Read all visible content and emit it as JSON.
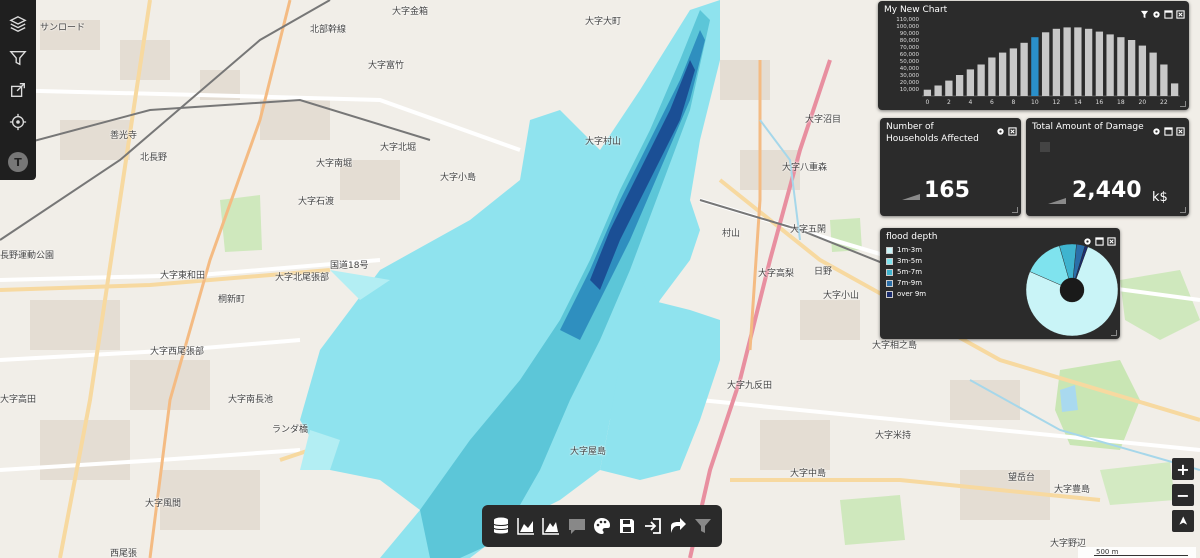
{
  "map": {
    "labels": [
      "大字金箱",
      "大字大町",
      "北部幹線",
      "サンロード",
      "大字富竹",
      "大字石渡",
      "大字北堀",
      "大字南堀",
      "大字小島",
      "大字村山",
      "善光寺",
      "北長野",
      "長野運動公園",
      "大字東和田",
      "大字北尾張部",
      "桐新町",
      "国道18号",
      "大字西尾張部",
      "大字高田",
      "大字南長池",
      "大字屋島",
      "大字八重森",
      "大字五閑",
      "大字高梨",
      "大字小山",
      "大字相之島",
      "大字九反田",
      "大字米持",
      "大字中島",
      "大字豊島",
      "望岳台",
      "大字野辺",
      "大字風間",
      "西尾張",
      "村山",
      "日野",
      "大字沼目",
      "ランダ橋"
    ],
    "route_shields": [
      "60",
      "406",
      "19",
      "58",
      "18",
      "117",
      "34",
      "58",
      "E18",
      "E18"
    ]
  },
  "left_toolbar": {
    "icons": [
      "layers-icon",
      "filter-icon",
      "share-icon",
      "location-icon"
    ],
    "avatar_letter": "T"
  },
  "bar_widget": {
    "title": "My New Chart",
    "highlight_color": "#2a8fc9",
    "bar_color": "#c8c8c8"
  },
  "households_widget": {
    "title_line1": "Number of",
    "title_line2": "Households Affected",
    "value": "165"
  },
  "damage_widget": {
    "title": "Total Amount of Damage",
    "value": "2,440",
    "unit": "k$"
  },
  "flood_widget": {
    "title": "flood depth",
    "legend": [
      {
        "label": "1m-3m",
        "color": "#c9f4f7"
      },
      {
        "label": "3m-5m",
        "color": "#7fe3ee"
      },
      {
        "label": "5m-7m",
        "color": "#3fb4cf"
      },
      {
        "label": "7m-9m",
        "color": "#2a6ea8"
      },
      {
        "label": "over 9m",
        "color": "#1b2d6e"
      }
    ]
  },
  "bottom_toolbar": {
    "icons": [
      "database-icon",
      "area-chart-icon",
      "mountain-chart-icon",
      "comment-icon",
      "palette-icon",
      "save-icon",
      "import-icon",
      "share-icon",
      "filter-icon"
    ]
  },
  "zoom": {
    "in": "+",
    "out": "−",
    "north": "➤"
  },
  "scale": {
    "label": "500 m"
  },
  "chart_data": [
    {
      "type": "bar",
      "title": "My New Chart",
      "categories": [
        0,
        1,
        2,
        3,
        4,
        5,
        6,
        7,
        8,
        9,
        10,
        11,
        12,
        13,
        14,
        15,
        16,
        17,
        18,
        19,
        20,
        21,
        22,
        23
      ],
      "values": [
        9000,
        15000,
        22000,
        30000,
        38000,
        45000,
        55000,
        62000,
        68000,
        76000,
        84000,
        91000,
        96000,
        98000,
        98000,
        96000,
        92000,
        88000,
        84000,
        80000,
        72000,
        62000,
        45000,
        18000
      ],
      "highlight_index": 10,
      "xticks": [
        "0",
        "2",
        "4",
        "6",
        "8",
        "10",
        "12",
        "14",
        "16",
        "18",
        "20",
        "22"
      ],
      "yticks": [
        "10,000",
        "20,000",
        "30,000",
        "40,000",
        "50,000",
        "60,000",
        "70,000",
        "80,000",
        "90,000",
        "100,000",
        "110,000"
      ],
      "ylim": [
        0,
        110000
      ],
      "xlabel": "",
      "ylabel": ""
    },
    {
      "type": "pie",
      "title": "flood depth",
      "labels": [
        "1m-3m",
        "3m-5m",
        "5m-7m",
        "7m-9m",
        "over 9m"
      ],
      "values": [
        76,
        14,
        6,
        3,
        1
      ],
      "colors": [
        "#c9f4f7",
        "#7fe3ee",
        "#3fb4cf",
        "#2a6ea8",
        "#1b2d6e"
      ],
      "donut": true
    }
  ]
}
